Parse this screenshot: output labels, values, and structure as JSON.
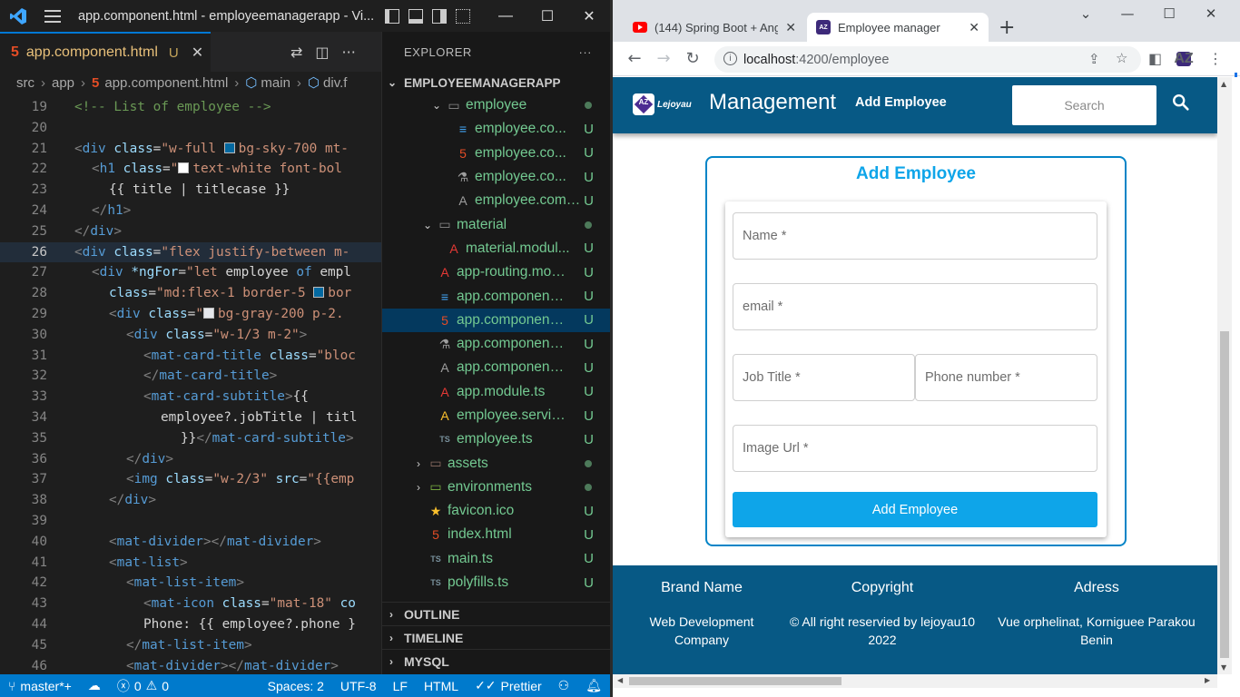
{
  "vscode": {
    "window_title": "app.component.html - employeemanagerapp - Vi...",
    "tab": {
      "name": "app.component.html",
      "status": "U"
    },
    "breadcrumb": [
      "src",
      "app",
      "app.component.html",
      "main",
      "div.f"
    ],
    "code_lines": [
      {
        "n": "19",
        "html": "<span class='c-com'>&lt;!-- List of employee --&gt;</span>",
        "indent": 1
      },
      {
        "n": "20",
        "html": "",
        "indent": 0
      },
      {
        "n": "21",
        "html": "<span class='c-punc'>&lt;</span><span class='c-tag'>div</span> <span class='c-attr'>class</span>=<span class='c-str'>\"w-full <span class='c-sw' style='background:#0369a1'></span>bg-sky-700 mt-</span>",
        "indent": 1
      },
      {
        "n": "22",
        "html": "<span class='c-punc'>&lt;</span><span class='c-tag'>h1</span> <span class='c-attr'>class</span>=<span class='c-str'>\"<span class='c-sw' style='background:#ffffff'></span>text-white font-bol</span>",
        "indent": 2
      },
      {
        "n": "23",
        "html": "<span class='c-txt'>{{ title | titlecase }}</span>",
        "indent": 3
      },
      {
        "n": "24",
        "html": "<span class='c-punc'>&lt;/</span><span class='c-tag'>h1</span><span class='c-punc'>&gt;</span>",
        "indent": 2
      },
      {
        "n": "25",
        "html": "<span class='c-punc'>&lt;/</span><span class='c-tag'>div</span><span class='c-punc'>&gt;</span>",
        "indent": 1
      },
      {
        "n": "26",
        "html": "<span class='c-punc'>&lt;</span><span class='c-tag'>div</span> <span class='c-attr'>class</span>=<span class='c-str'>\"flex justify-between m-</span>",
        "indent": 1,
        "active": true
      },
      {
        "n": "27",
        "html": "<span class='c-punc'>&lt;</span><span class='c-tag'>div</span> <span class='c-attr'>*ngFor</span>=<span class='c-str'>\"let</span> <span class='c-txt'>employee</span> <span class='c-tag'>of</span> <span class='c-txt'>empl</span>",
        "indent": 2
      },
      {
        "n": "28",
        "html": "<span class='c-attr'>class</span>=<span class='c-str'>\"md:flex-1 border-5 <span class='c-sw' style='background:#0369a1'></span>bor</span>",
        "indent": 3
      },
      {
        "n": "29",
        "html": "<span class='c-punc'>&lt;</span><span class='c-tag'>div</span> <span class='c-attr'>class</span>=<span class='c-str'>\"<span class='c-sw' style='background:#e5e7eb'></span>bg-gray-200 p-2.</span>",
        "indent": 3
      },
      {
        "n": "30",
        "html": "<span class='c-punc'>&lt;</span><span class='c-tag'>div</span> <span class='c-attr'>class</span>=<span class='c-str'>\"w-1/3 m-2\"</span><span class='c-punc'>&gt;</span>",
        "indent": 4
      },
      {
        "n": "31",
        "html": "<span class='c-punc'>&lt;</span><span class='c-tag'>mat-card-title</span> <span class='c-attr'>class</span>=<span class='c-str'>\"bloc</span>",
        "indent": 5
      },
      {
        "n": "32",
        "html": "<span class='c-punc'>&lt;/</span><span class='c-tag'>mat-card-title</span><span class='c-punc'>&gt;</span>",
        "indent": 5
      },
      {
        "n": "33",
        "html": "<span class='c-punc'>&lt;</span><span class='c-tag'>mat-card-subtitle</span><span class='c-punc'>&gt;</span><span class='c-txt'>{{</span>",
        "indent": 5
      },
      {
        "n": "34",
        "html": "<span class='c-txt'>employee?.jobTitle | titl</span>",
        "indent": 6
      },
      {
        "n": "35",
        "html": "<span class='c-txt'>}}</span><span class='c-punc'>&lt;/</span><span class='c-tag'>mat-card-subtitle</span><span class='c-punc'>&gt;</span>",
        "indent": 6,
        "extra": "  "
      },
      {
        "n": "36",
        "html": "<span class='c-punc'>&lt;/</span><span class='c-tag'>div</span><span class='c-punc'>&gt;</span>",
        "indent": 4
      },
      {
        "n": "37",
        "html": "<span class='c-punc'>&lt;</span><span class='c-tag'>img</span> <span class='c-attr'>class</span>=<span class='c-str'>\"w-2/3\"</span> <span class='c-attr'>src</span>=<span class='c-str'>\"{{emp</span>",
        "indent": 4
      },
      {
        "n": "38",
        "html": "<span class='c-punc'>&lt;/</span><span class='c-tag'>div</span><span class='c-punc'>&gt;</span>",
        "indent": 3
      },
      {
        "n": "39",
        "html": "",
        "indent": 0
      },
      {
        "n": "40",
        "html": "<span class='c-punc'>&lt;</span><span class='c-tag'>mat-divider</span><span class='c-punc'>&gt;&lt;/</span><span class='c-tag'>mat-divider</span><span class='c-punc'>&gt;</span>",
        "indent": 3
      },
      {
        "n": "41",
        "html": "<span class='c-punc'>&lt;</span><span class='c-tag'>mat-list</span><span class='c-punc'>&gt;</span>",
        "indent": 3
      },
      {
        "n": "42",
        "html": "<span class='c-punc'>&lt;</span><span class='c-tag'>mat-list-item</span><span class='c-punc'>&gt;</span>",
        "indent": 4
      },
      {
        "n": "43",
        "html": "<span class='c-punc'>&lt;</span><span class='c-tag'>mat-icon</span> <span class='c-attr'>class</span>=<span class='c-str'>\"mat-18\"</span> <span class='c-attr'>co</span>",
        "indent": 5
      },
      {
        "n": "44",
        "html": "<span class='c-txt'>Phone: {{ employee?.phone }</span>",
        "indent": 5
      },
      {
        "n": "45",
        "html": "<span class='c-punc'>&lt;/</span><span class='c-tag'>mat-list-item</span><span class='c-punc'>&gt;</span>",
        "indent": 4
      },
      {
        "n": "46",
        "html": "<span class='c-punc'>&lt;</span><span class='c-tag'>mat-divider</span><span class='c-punc'>&gt;&lt;/</span><span class='c-tag'>mat-divider</span><span class='c-punc'>&gt;</span>",
        "indent": 4
      }
    ],
    "explorer": {
      "title": "EXPLORER",
      "root": "EMPLOYEEMANAGERAPP",
      "items": [
        {
          "label": "employee",
          "kind": "folder",
          "open": true,
          "depth": 2,
          "icon": "folder-icon",
          "glyph": "▭",
          "color": "#8a8a8a",
          "status": "dot"
        },
        {
          "label": "employee.co...",
          "kind": "file",
          "depth": 3,
          "icon": "css-file-icon",
          "glyph": "≡",
          "color": "#42a5f5",
          "status": "U"
        },
        {
          "label": "employee.co...",
          "kind": "file",
          "depth": 3,
          "icon": "html-file-icon",
          "glyph": "5",
          "color": "#e44d26",
          "status": "U"
        },
        {
          "label": "employee.co...",
          "kind": "file",
          "depth": 3,
          "icon": "test-file-icon",
          "glyph": "⚗",
          "color": "#9e9e9e",
          "status": "U"
        },
        {
          "label": "employee.compon...",
          "kind": "file",
          "depth": 3,
          "icon": "angular-file-icon",
          "glyph": "A",
          "color": "#9e9e9e",
          "status": "U"
        },
        {
          "label": "material",
          "kind": "folder",
          "open": true,
          "depth": 1,
          "icon": "folder-icon",
          "glyph": "▭",
          "color": "#8a8a8a",
          "status": "dot"
        },
        {
          "label": "material.modul...",
          "kind": "file",
          "depth": 2,
          "icon": "angular-file-icon",
          "glyph": "A",
          "color": "#e53935",
          "status": "U"
        },
        {
          "label": "app-routing.mod...",
          "kind": "file",
          "depth": 1,
          "icon": "angular-file-icon",
          "glyph": "A",
          "color": "#e53935",
          "status": "U"
        },
        {
          "label": "app.component....",
          "kind": "file",
          "depth": 1,
          "icon": "css-file-icon",
          "glyph": "≡",
          "color": "#42a5f5",
          "status": "U"
        },
        {
          "label": "app.component....",
          "kind": "file",
          "depth": 1,
          "icon": "html-file-icon",
          "glyph": "5",
          "color": "#e44d26",
          "status": "U",
          "selected": true
        },
        {
          "label": "app.component.s...",
          "kind": "file",
          "depth": 1,
          "icon": "test-file-icon",
          "glyph": "⚗",
          "color": "#9e9e9e",
          "status": "U"
        },
        {
          "label": "app.component.ts",
          "kind": "file",
          "depth": 1,
          "icon": "angular-file-icon",
          "glyph": "A",
          "color": "#9e9e9e",
          "status": "U"
        },
        {
          "label": "app.module.ts",
          "kind": "file",
          "depth": 1,
          "icon": "angular-file-icon",
          "glyph": "A",
          "color": "#e53935",
          "status": "U"
        },
        {
          "label": "employee.service....",
          "kind": "file",
          "depth": 1,
          "icon": "angular-service-icon",
          "glyph": "A",
          "color": "#fbc02d",
          "status": "U"
        },
        {
          "label": "employee.ts",
          "kind": "file",
          "depth": 1,
          "icon": "typescript-file-icon",
          "glyph": "TS",
          "color": "#78909c",
          "status": "U"
        },
        {
          "label": "assets",
          "kind": "folder",
          "open": false,
          "depth": 0,
          "icon": "folder-icon",
          "glyph": "▭",
          "color": "#8d6e63",
          "status": "dot"
        },
        {
          "label": "environments",
          "kind": "folder",
          "open": false,
          "depth": 0,
          "icon": "folder-icon",
          "glyph": "▭",
          "color": "#7cb342",
          "status": "dot"
        },
        {
          "label": "favicon.ico",
          "kind": "file",
          "depth": 0,
          "icon": "star-icon",
          "glyph": "★",
          "color": "#fbc02d",
          "status": "U"
        },
        {
          "label": "index.html",
          "kind": "file",
          "depth": 0,
          "icon": "html-file-icon",
          "glyph": "5",
          "color": "#e44d26",
          "status": "U"
        },
        {
          "label": "main.ts",
          "kind": "file",
          "depth": 0,
          "icon": "typescript-file-icon",
          "glyph": "TS",
          "color": "#78909c",
          "status": "U"
        },
        {
          "label": "polyfills.ts",
          "kind": "file",
          "depth": 0,
          "icon": "typescript-file-icon",
          "glyph": "TS",
          "color": "#78909c",
          "status": "U"
        }
      ],
      "sections": [
        "OUTLINE",
        "TIMELINE",
        "MYSQL"
      ]
    },
    "status": {
      "branch": "master*+",
      "errors": "0",
      "warnings": "0",
      "spaces": "Spaces: 2",
      "encoding": "UTF-8",
      "eol": "LF",
      "language": "HTML",
      "formatter": "Prettier"
    }
  },
  "chrome": {
    "tabs": [
      {
        "label": "(144) Spring Boot + Angu",
        "icon": "youtube-icon"
      },
      {
        "label": "Employee manager",
        "icon": "app-favicon-icon",
        "active": true
      }
    ],
    "url_host": "localhost",
    "url_path": ":4200/employee"
  },
  "app": {
    "logo_text": "Lejoyau",
    "logo_badge": "AZ",
    "title": "Management",
    "nav_link": "Add Employee",
    "search_placeholder": "Search",
    "form": {
      "title": "Add Employee",
      "name_placeholder": "Name *",
      "email_placeholder": "email *",
      "job_placeholder": "Job Title *",
      "phone_placeholder": "Phone number *",
      "image_placeholder": "Image Url *",
      "submit_label": "Add Employee"
    },
    "footer": {
      "col1_title": "Brand Name",
      "col1_line1": "Web Development",
      "col1_line2": "Company",
      "col2_title": "Copyright",
      "col2_line1": "© All right reservied by lejoyau10",
      "col2_line2": "2022",
      "col3_title": "Adress",
      "col3_line1": "Vue orphelinat, Korniguee Parakou",
      "col3_line2": "Benin"
    }
  }
}
